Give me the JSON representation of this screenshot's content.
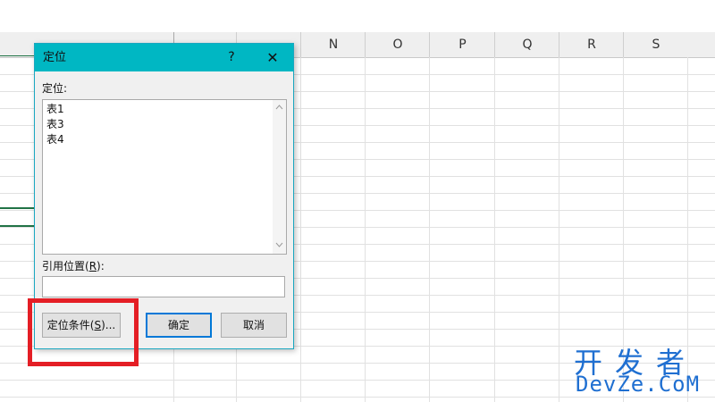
{
  "spreadsheet": {
    "columns": [
      "N",
      "O",
      "P",
      "Q",
      "R",
      "S"
    ]
  },
  "dialog": {
    "title": "定位",
    "help_label": "?",
    "close_label": "✕",
    "list_label": "定位:",
    "items": [
      "表1",
      "表3",
      "表4"
    ],
    "reference_label_prefix": "引用位置(",
    "reference_label_key": "R",
    "reference_label_suffix": "):",
    "reference_value": "",
    "special_button_prefix": "定位条件(",
    "special_button_key": "S",
    "special_button_suffix": ")...",
    "ok_label": "确定",
    "cancel_label": "取消"
  },
  "watermark": {
    "line1": "开发者",
    "line2": "DevZe.CoM"
  },
  "colors": {
    "titlebar": "#00b7c3",
    "highlight": "#e41e25",
    "accent": "#0078d7"
  }
}
